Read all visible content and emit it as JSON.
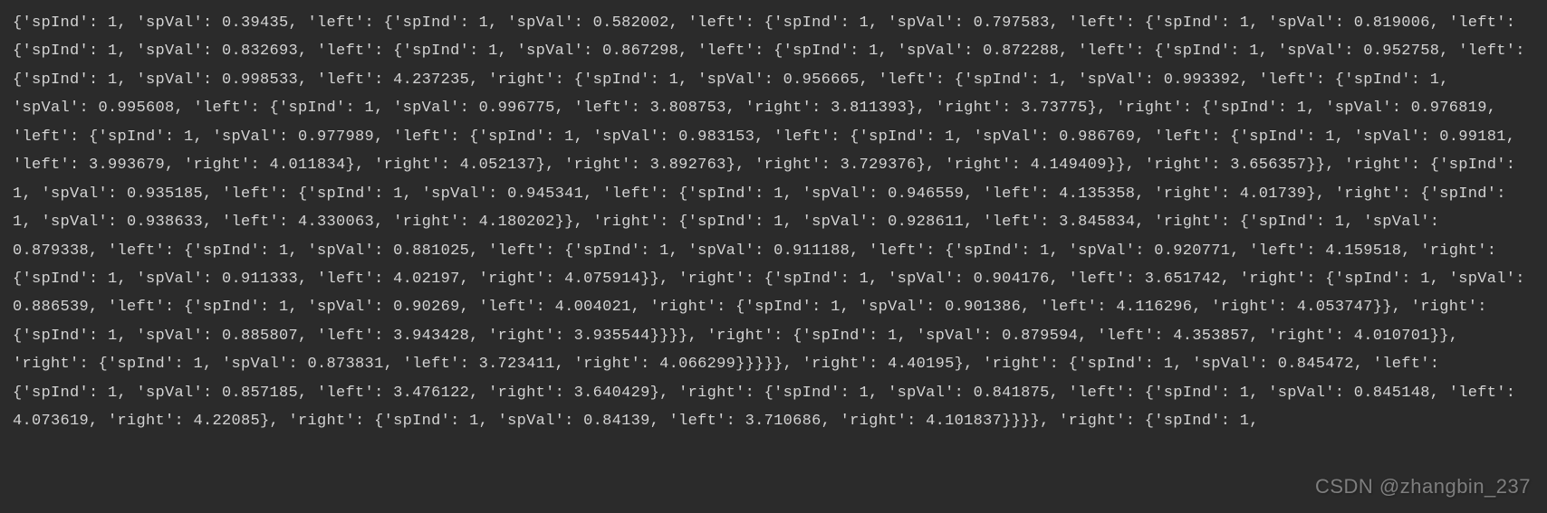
{
  "console": {
    "output": "{'spInd': 1, 'spVal': 0.39435, 'left': {'spInd': 1, 'spVal': 0.582002, 'left': {'spInd': 1, 'spVal': 0.797583, 'left': {'spInd': 1, 'spVal': 0.819006, 'left': {'spInd': 1, 'spVal': 0.832693, 'left': {'spInd': 1, 'spVal': 0.867298, 'left': {'spInd': 1, 'spVal': 0.872288, 'left': {'spInd': 1, 'spVal': 0.952758, 'left': {'spInd': 1, 'spVal': 0.998533, 'left': 4.237235, 'right': {'spInd': 1, 'spVal': 0.956665, 'left': {'spInd': 1, 'spVal': 0.993392, 'left': {'spInd': 1, 'spVal': 0.995608, 'left': {'spInd': 1, 'spVal': 0.996775, 'left': 3.808753, 'right': 3.811393}, 'right': 3.73775}, 'right': {'spInd': 1, 'spVal': 0.976819, 'left': {'spInd': 1, 'spVal': 0.977989, 'left': {'spInd': 1, 'spVal': 0.983153, 'left': {'spInd': 1, 'spVal': 0.986769, 'left': {'spInd': 1, 'spVal': 0.99181, 'left': 3.993679, 'right': 4.011834}, 'right': 4.052137}, 'right': 3.892763}, 'right': 3.729376}, 'right': 4.149409}}, 'right': 3.656357}}, 'right': {'spInd': 1, 'spVal': 0.935185, 'left': {'spInd': 1, 'spVal': 0.945341, 'left': {'spInd': 1, 'spVal': 0.946559, 'left': 4.135358, 'right': 4.01739}, 'right': {'spInd': 1, 'spVal': 0.938633, 'left': 4.330063, 'right': 4.180202}}, 'right': {'spInd': 1, 'spVal': 0.928611, 'left': 3.845834, 'right': {'spInd': 1, 'spVal': 0.879338, 'left': {'spInd': 1, 'spVal': 0.881025, 'left': {'spInd': 1, 'spVal': 0.911188, 'left': {'spInd': 1, 'spVal': 0.920771, 'left': 4.159518, 'right': {'spInd': 1, 'spVal': 0.911333, 'left': 4.02197, 'right': 4.075914}}, 'right': {'spInd': 1, 'spVal': 0.904176, 'left': 3.651742, 'right': {'spInd': 1, 'spVal': 0.886539, 'left': {'spInd': 1, 'spVal': 0.90269, 'left': 4.004021, 'right': {'spInd': 1, 'spVal': 0.901386, 'left': 4.116296, 'right': 4.053747}}, 'right': {'spInd': 1, 'spVal': 0.885807, 'left': 3.943428, 'right': 3.935544}}}}, 'right': {'spInd': 1, 'spVal': 0.879594, 'left': 4.353857, 'right': 4.010701}}, 'right': {'spInd': 1, 'spVal': 0.873831, 'left': 3.723411, 'right': 4.066299}}}}}, 'right': 4.40195}, 'right': {'spInd': 1, 'spVal': 0.845472, 'left': {'spInd': 1, 'spVal': 0.857185, 'left': 3.476122, 'right': 3.640429}, 'right': {'spInd': 1, 'spVal': 0.841875, 'left': {'spInd': 1, 'spVal': 0.845148, 'left': 4.073619, 'right': 4.22085}, 'right': {'spInd': 1, 'spVal': 0.84139, 'left': 3.710686, 'right': 4.101837}}}}, 'right': {'spInd': 1,"
  },
  "watermark": {
    "text": "CSDN @zhangbin_237"
  }
}
